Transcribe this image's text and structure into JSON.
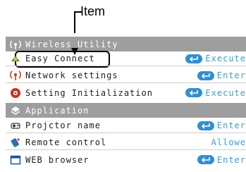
{
  "callout": {
    "label": "Item"
  },
  "menu": {
    "rows": [
      {
        "kind": "header",
        "label": "Wireless Utility",
        "icon": "antenna-icon"
      },
      {
        "kind": "item",
        "label": "Easy Connect",
        "icon": "connect-icon",
        "action": "Execute",
        "selected": true
      },
      {
        "kind": "item",
        "label": "Network settings",
        "icon": "network-icon",
        "action": "Enter"
      },
      {
        "kind": "item",
        "label": "Setting Initialization",
        "icon": "reset-icon",
        "action": "Execute"
      },
      {
        "kind": "header",
        "label": "Application",
        "icon": "application-icon"
      },
      {
        "kind": "item",
        "label": "Projctor name",
        "icon": "projector-icon",
        "action": "Enter"
      },
      {
        "kind": "item",
        "label": "Remote control",
        "icon": "remote-icon",
        "value": "Allowe"
      },
      {
        "kind": "item",
        "label": "WEB browser",
        "icon": "browser-icon",
        "action": "Enter"
      }
    ]
  },
  "colors": {
    "header_bg": "#9e9e9e",
    "action_text": "#3aa0d8",
    "enter_button": "#2f8fd0"
  }
}
